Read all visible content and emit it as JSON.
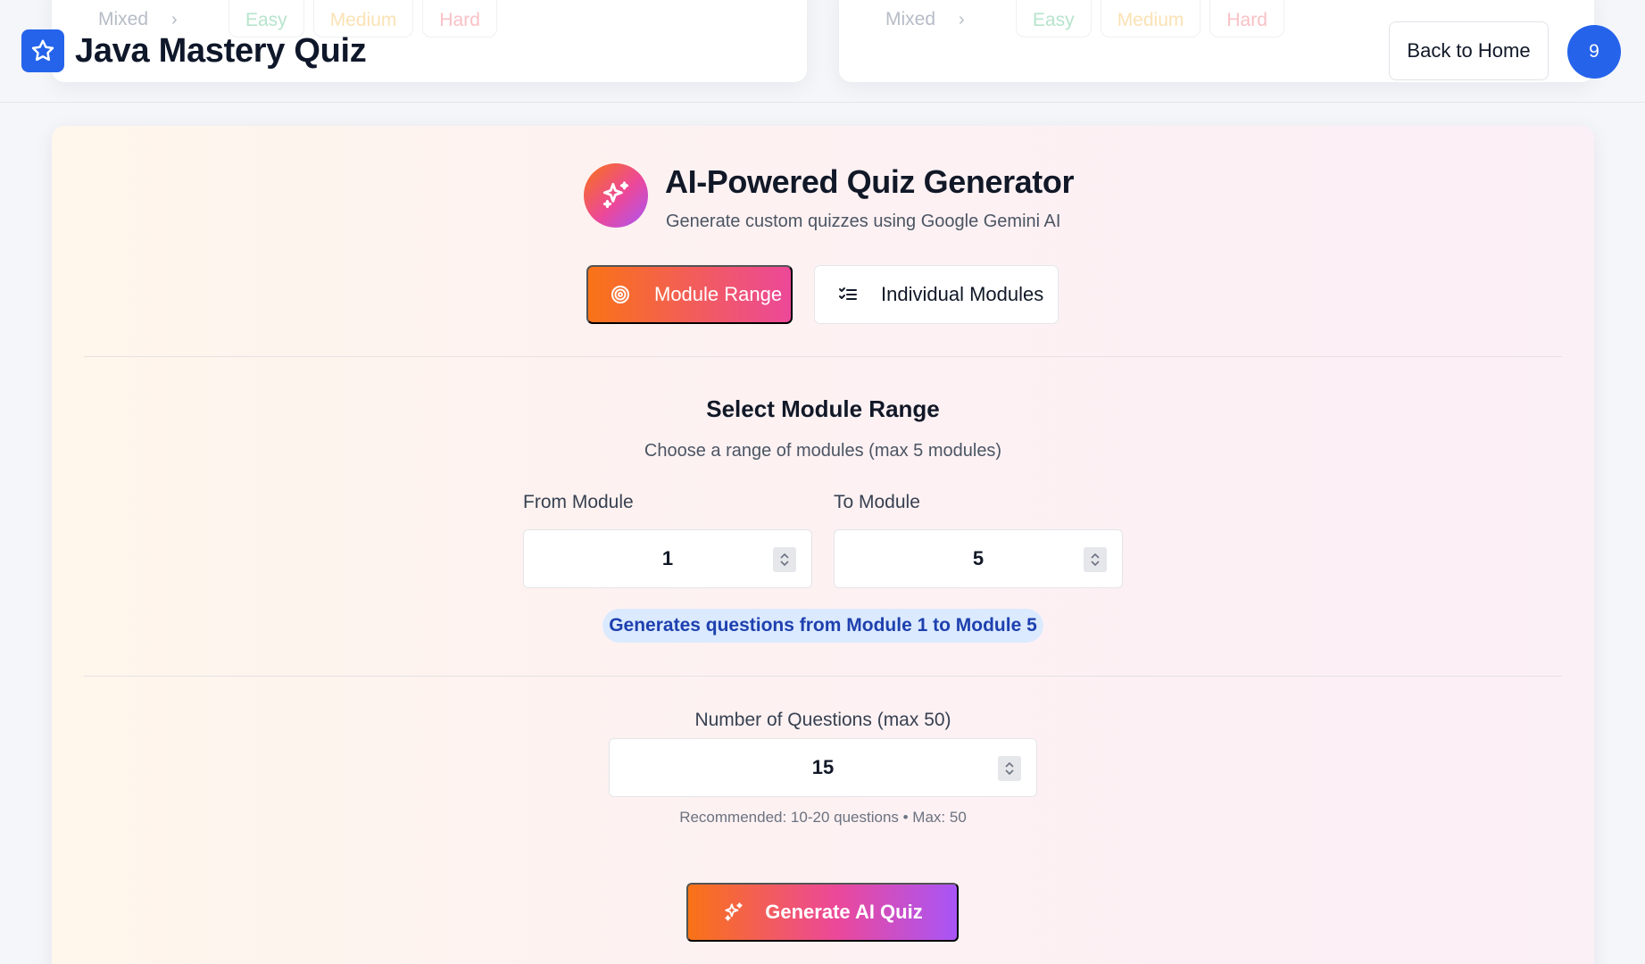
{
  "background_cards": [
    {
      "mixed_label": "Mixed",
      "levels": [
        "Easy",
        "Medium",
        "Hard"
      ]
    },
    {
      "mixed_label": "Mixed",
      "levels": [
        "Easy",
        "Medium",
        "Hard"
      ]
    }
  ],
  "header": {
    "logo_icon": "star-icon",
    "title": "Java Mastery Quiz",
    "back_button": "Back to Home",
    "avatar_text": "9"
  },
  "generator": {
    "icon": "sparkles-icon",
    "title": "AI-Powered Quiz Generator",
    "subtitle": "Generate custom quizzes using Google Gemini AI",
    "modes": [
      {
        "label": "Module Range",
        "icon": "target-icon",
        "active": true
      },
      {
        "label": "Individual Modules",
        "icon": "checklist-icon",
        "active": false
      }
    ],
    "range_section": {
      "title": "Select Module Range",
      "subtitle": "Choose a range of modules (max 5 modules)",
      "from_label": "From Module",
      "from_value": "1",
      "to_label": "To Module",
      "to_value": "5",
      "summary": "Generates questions from Module 1 to Module 5"
    },
    "questions": {
      "label": "Number of Questions (max 50)",
      "value": "15",
      "hint": "Recommended: 10-20 questions • Max: 50"
    },
    "generate_button": "Generate AI Quiz"
  },
  "colors": {
    "brand_blue": "#2563eb",
    "gradient_orange": "#f97316",
    "gradient_pink": "#ec4899",
    "gradient_purple": "#a855f7",
    "badge_bg": "#dbeafe",
    "badge_text": "#1e40af"
  }
}
